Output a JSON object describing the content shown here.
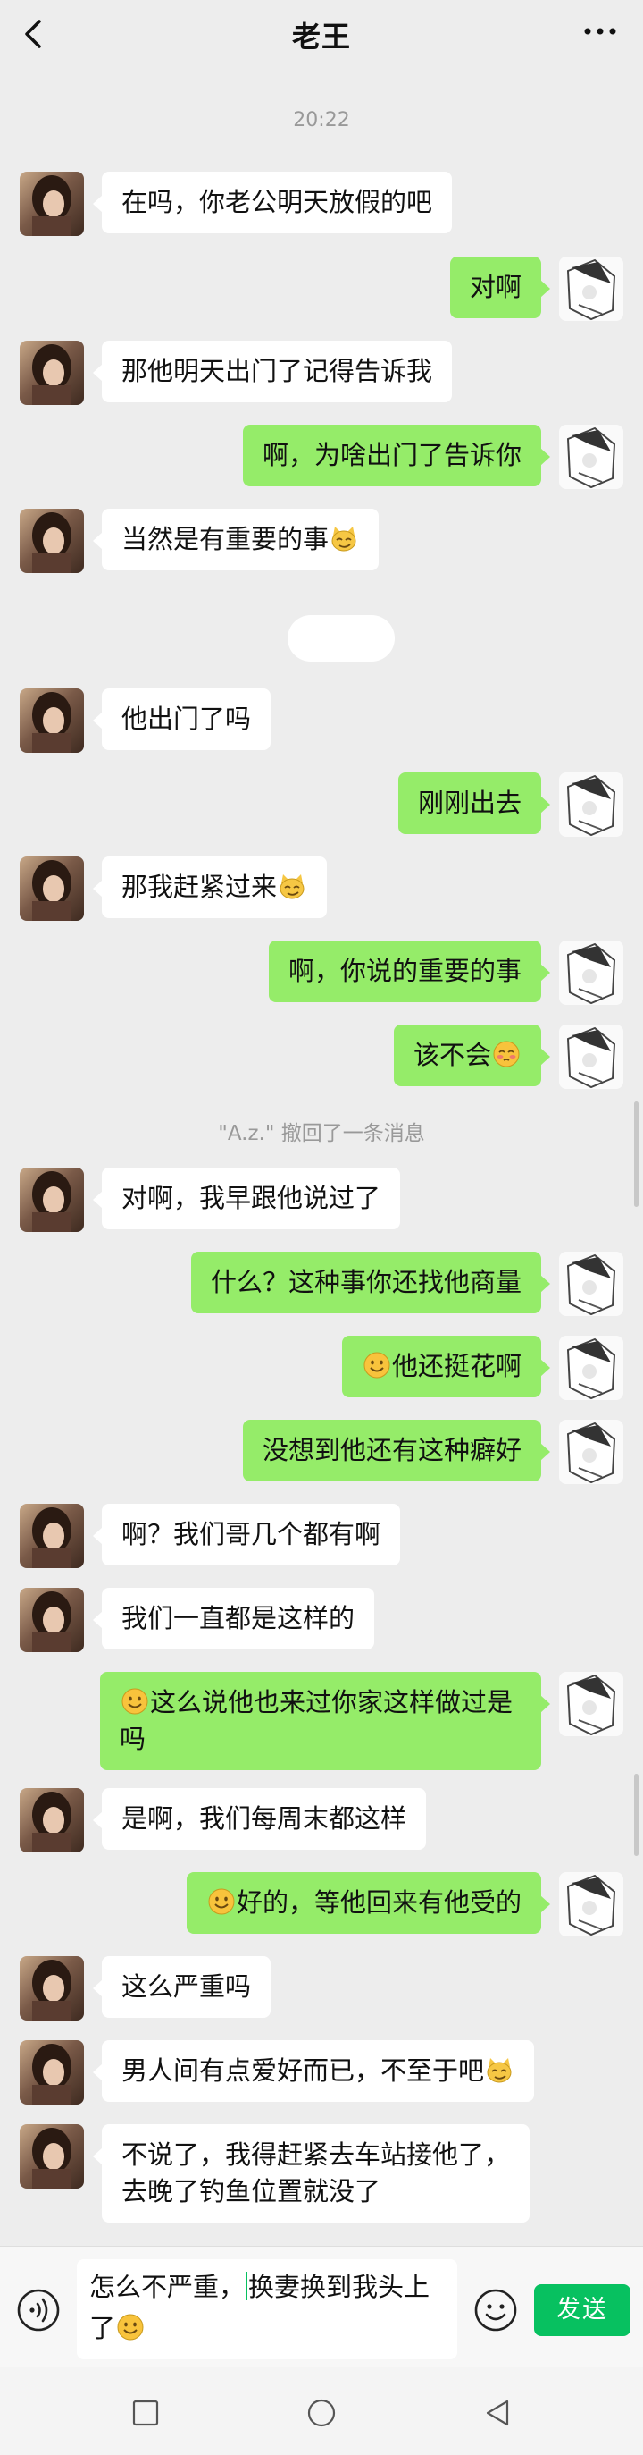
{
  "header": {
    "title": "老王"
  },
  "timestamp": "20:22",
  "notice": "\"A.z.\" 撤回了一条消息",
  "messages": [
    {
      "text": "在吗，你老公明天放假的吧"
    },
    {
      "text": "对啊"
    },
    {
      "text": "那他明天出门了记得告诉我"
    },
    {
      "text": "啊，为啥出门了告诉你"
    },
    {
      "text": "当然是有重要的事",
      "emoji": "cat-smirk-emoji"
    },
    {
      "text": "他出门了吗"
    },
    {
      "text": "刚刚出去"
    },
    {
      "text": "那我赶紧过来",
      "emoji": "cat-smirk-emoji"
    },
    {
      "text": "啊，你说的重要的事"
    },
    {
      "text": "该不会",
      "emoji": "blushing-emoji"
    },
    {
      "text": "对啊，我早跟他说过了"
    },
    {
      "text": "什么？这种事你还找他商量"
    },
    {
      "text": "他还挺花啊",
      "emoji": "smile-emoji"
    },
    {
      "text": "没想到他还有这种癖好"
    },
    {
      "text": "啊？我们哥几个都有啊"
    },
    {
      "text": "我们一直都是这样的"
    },
    {
      "text": "这么说他也来过你家这样做过是\n吗",
      "emoji": "smile-emoji"
    },
    {
      "text": "是啊，我们每周末都这样"
    },
    {
      "text": "好的，等他回来有他受的",
      "emoji": "smile-emoji"
    },
    {
      "text": "这么严重吗"
    },
    {
      "text": "男人间有点爱好而已，不至于吧",
      "emoji": "cat-smirk-emoji"
    },
    {
      "text": "不说了，我得赶紧去车站接他了，\n去晚了钓鱼位置就没了"
    }
  ],
  "input": {
    "line1_before": "怎么不严重，",
    "line1_after": "换妻换到我头上",
    "line2": "了",
    "emoji": "smile-emoji"
  },
  "send_label": "发送",
  "icons": {
    "back": "back-arrow-icon",
    "more": "more-icon",
    "voice": "voice-icon",
    "emoji_picker": "emoji-picker-icon",
    "nav_recent": "square-icon",
    "nav_home": "circle-icon",
    "nav_back": "triangle-back-icon"
  },
  "colors": {
    "background": "#ededed",
    "bubble_sent": "#95ec69",
    "bubble_received": "#ffffff",
    "send_button": "#07c160"
  }
}
